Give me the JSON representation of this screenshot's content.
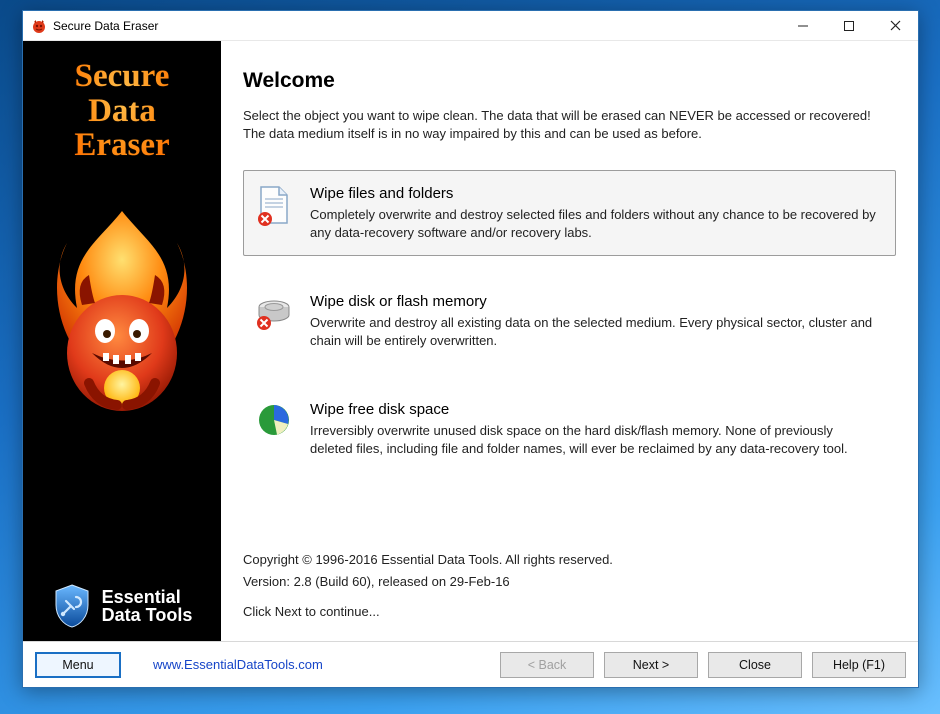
{
  "window": {
    "title": "Secure Data Eraser"
  },
  "sidebar": {
    "product_line1": "Secure",
    "product_line2": "Data",
    "product_line3": "Eraser",
    "brand_line1": "Essential",
    "brand_line2": "Data Tools"
  },
  "main": {
    "heading": "Welcome",
    "intro": "Select the object you want to wipe clean. The data that will be erased can NEVER be accessed or recovered! The data medium itself is in no way impaired by this and can be used as before.",
    "options": [
      {
        "title": "Wipe files and folders",
        "desc": "Completely overwrite and destroy selected files and folders without any chance to be recovered by any data-recovery software and/or recovery labs."
      },
      {
        "title": "Wipe disk or flash memory",
        "desc": "Overwrite and destroy all existing data on the selected medium. Every physical sector, cluster and chain will be entirely overwritten."
      },
      {
        "title": "Wipe free disk space",
        "desc": "Irreversibly overwrite unused disk space on the hard disk/flash memory. None of previously deleted files, including file and folder names, will ever be reclaimed by any data-recovery tool."
      }
    ],
    "copyright": "Copyright © 1996-2016 Essential Data Tools. All rights reserved.",
    "version": "Version: 2.8 (Build 60), released on 29-Feb-16",
    "continue_hint": "Click Next to continue..."
  },
  "buttons": {
    "menu": "Menu",
    "link": "www.EssentialDataTools.com",
    "back": "< Back",
    "next": "Next >",
    "close": "Close",
    "help": "Help (F1)"
  }
}
